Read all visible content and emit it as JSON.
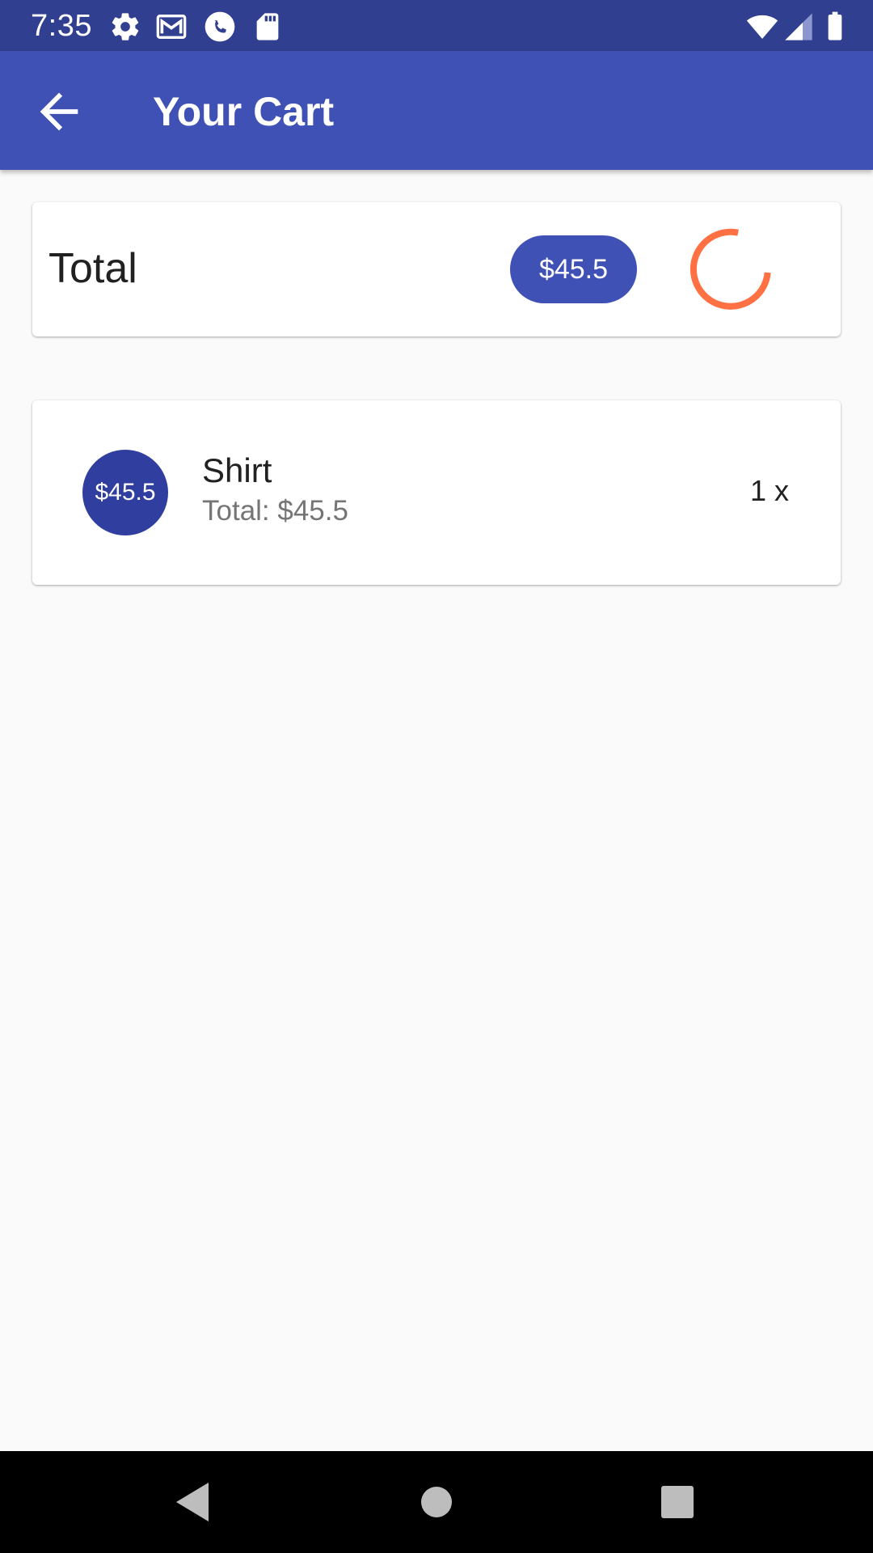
{
  "status_bar": {
    "time": "7:35",
    "icons": [
      "settings-icon",
      "gmail-icon",
      "phone-icon",
      "sd-card-icon",
      "wifi-icon",
      "cell-signal-icon",
      "battery-icon"
    ]
  },
  "app_bar": {
    "title": "Your Cart",
    "back_icon": "arrow-back-icon"
  },
  "total_card": {
    "label": "Total",
    "amount": "$45.5",
    "spinner_color": "#ff7043"
  },
  "cart_items": [
    {
      "avatar_price": "$45.5",
      "name": "Shirt",
      "subtitle": "Total: $45.5",
      "quantity": "1 x"
    }
  ],
  "colors": {
    "primary": "#3f51b5",
    "primary_dark": "#303f9f",
    "accent": "#ff7043",
    "background": "#fafafa"
  },
  "nav_bar": {
    "buttons": [
      "back-triangle-icon",
      "home-circle-icon",
      "recents-square-icon"
    ]
  }
}
